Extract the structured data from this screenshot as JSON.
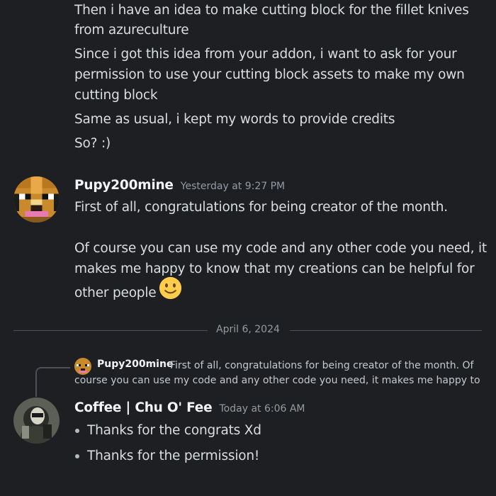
{
  "messages_top": {
    "lines": [
      "Then i have an idea to make cutting block for the fillet knives",
      "from azureculture",
      "Since i got this idea from your addon, i want to ask for your",
      "permission to use your cutting block assets to make my own",
      "cutting block",
      "Same as usual, i kept my words to provide credits",
      "So? :)"
    ]
  },
  "message_pupy": {
    "username": "Pupy200mine",
    "timestamp": "Yesterday at 9:27 PM",
    "lines": [
      "First of all, congratulations for being creator of the month.",
      "Of course you can use my code and any other code you need, it",
      "makes me happy to know that my creations can be helpful for",
      "other people"
    ],
    "emoji": "slightly-smiling-face"
  },
  "divider": {
    "date": "April 6, 2024"
  },
  "message_coffee": {
    "reply": {
      "username": "Pupy200mine",
      "line1": "First of all, congratulations for being creator of the month.  Of",
      "line2": "course you can use my code and any other code you need, it makes me happy to"
    },
    "username": "Coffee | Chu O' Fee",
    "timestamp": "Today at 6:06 AM",
    "bullets": [
      "Thanks for the congrats Xd",
      "Thanks for the permission!"
    ]
  },
  "colors": {
    "background": "#1e1f22",
    "text": "#dbdee1",
    "muted": "#949ba4",
    "username": "#f2f3f5"
  }
}
